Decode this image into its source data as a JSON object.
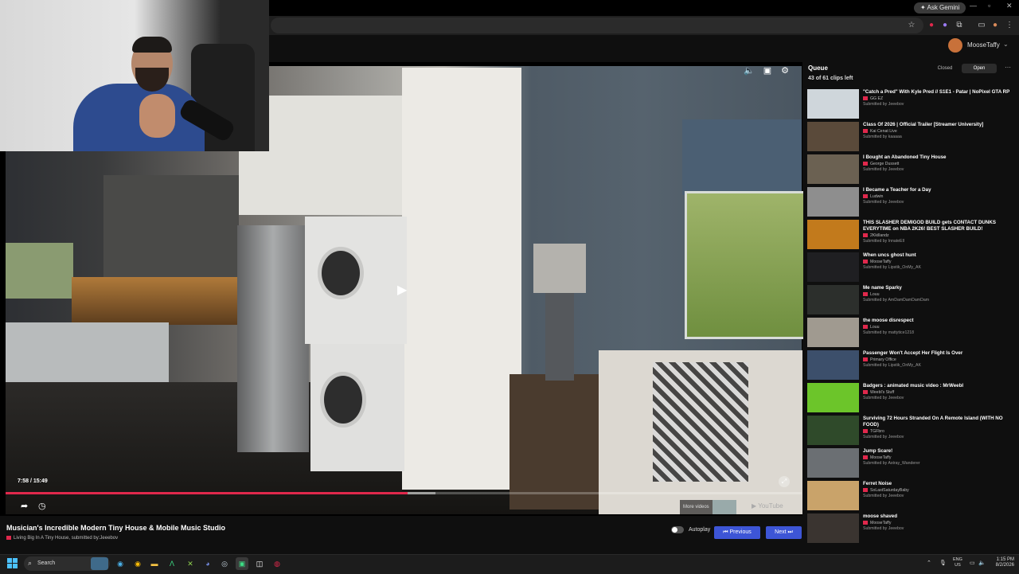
{
  "browser": {
    "gemini_label": "Ask Gemini"
  },
  "header": {
    "username": "MooseTaffy"
  },
  "player": {
    "timecode": "7:58 / 15:49",
    "progress_fraction": 0.505,
    "buffer_fraction": 0.54,
    "more_videos_label": "More videos",
    "youtube_label": "YouTube"
  },
  "video": {
    "title": "Musician's Incredible Modern Tiny House & Mobile Music Studio",
    "channel": "Living Big In A Tiny House",
    "submitted_prefix": ", submitted by:",
    "submitted_by": "Jeeebov"
  },
  "controls": {
    "autoplay_label": "Autoplay",
    "previous_label": "Previous",
    "next_label": "Next"
  },
  "queue": {
    "title": "Queue",
    "count_text": "43 of 61 clips left",
    "closed_label": "Closed",
    "open_label": "Open",
    "submitted_prefix": "Submitted by ",
    "items": [
      {
        "title": "\"Catch a Pred\" With Kyle Pred // S1E1 - Patar | NoPixel GTA RP",
        "channel": "GG EZ",
        "submitter": "Jeeebov",
        "color": "#cfd6db"
      },
      {
        "title": "Class Of 2026 | Official Trailer [Streamer University]",
        "channel": "Kai Cenat Live",
        "submitter": "kaaaaa",
        "color": "#5a4a3a"
      },
      {
        "title": "I Bought an Abandoned Tiny House",
        "channel": "George Dussett",
        "submitter": "Jeeebov",
        "color": "#6b6152"
      },
      {
        "title": "I Became a Teacher for a Day",
        "channel": "Ludwin",
        "submitter": "Jeeebov",
        "color": "#8e8e8e"
      },
      {
        "title": "THIS SLASHER DEMIGOD BUILD gets CONTACT DUNKS EVERYTIME on NBA 2K26! BEST SLASHER BUILD!",
        "channel": "2Kkillandz",
        "submitter": "InnateEll",
        "color": "#c27a1c"
      },
      {
        "title": "When uncs ghost hunt",
        "channel": "MooseTaffy",
        "submitter": "Lipstik_OnMy_AK",
        "color": "#1f1f22"
      },
      {
        "title": "Me name Sparky",
        "channel": "Louu",
        "submitter": "AmDamDamDamDam",
        "color": "#2c2f2c"
      },
      {
        "title": "the moose disrespect",
        "channel": "Louu",
        "submitter": "mattytice1218",
        "color": "#a09a90"
      },
      {
        "title": "Passenger Won't Accept Her Flight Is Over",
        "channel": "Primary Office",
        "submitter": "Lipstik_OnMy_AK",
        "color": "#3c4f6b"
      },
      {
        "title": "Badgers : animated music video : MrWeebl",
        "channel": "Weebl's Stuff",
        "submitter": "Jeeebov",
        "color": "#6cc52a"
      },
      {
        "title": "Surviving 72 Hours Stranded On A Remote Island (WITH NO FOOD)",
        "channel": "TGFbro",
        "submitter": "Jeeebov",
        "color": "#2f4a2a"
      },
      {
        "title": "Jump Scare!",
        "channel": "MooseTaffy",
        "submitter": "Astray_Wanderer",
        "color": "#6b6f73"
      },
      {
        "title": "Ferret Noise",
        "channel": "SoLastSaturdayBaby",
        "submitter": "Jeeebov",
        "color": "#c9a36a"
      },
      {
        "title": "moose shaved",
        "channel": "MooseTaffy",
        "submitter": "Jeeebov",
        "color": "#3a3430"
      }
    ]
  },
  "taskbar": {
    "search_placeholder": "Search",
    "lang_top": "ENG",
    "lang_bottom": "US",
    "time": "1:15 PM",
    "date": "8/2/2026"
  }
}
